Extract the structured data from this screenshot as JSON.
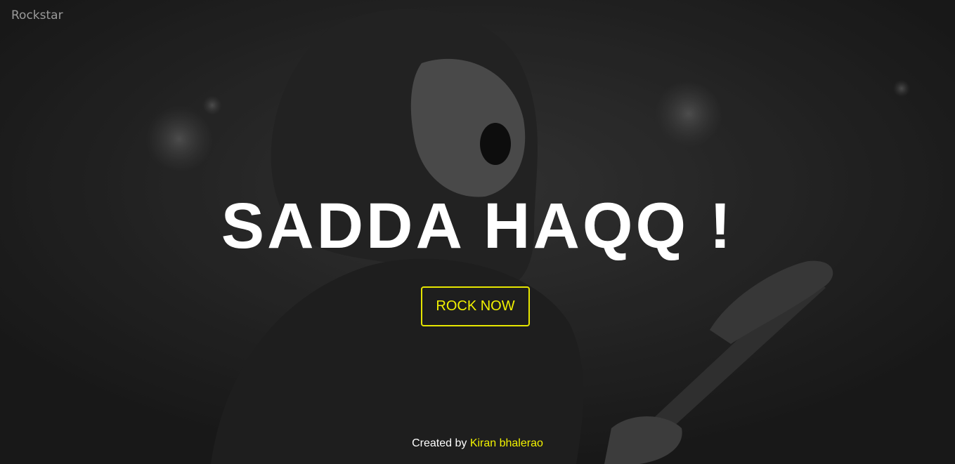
{
  "nav": {
    "brand": "Rockstar"
  },
  "hero": {
    "title": "SADDA HAQQ !",
    "cta_label": "ROCK NOW"
  },
  "footer": {
    "prefix": "Created by",
    "author": "Kiran bhalerao"
  },
  "colors": {
    "accent": "#f2f200",
    "text": "#ffffff",
    "brand_text": "#9a9a9a",
    "background": "#1c1c1c"
  },
  "background_image": {
    "subject": "black-and-white concert photo of a long-haired singer shouting while playing guitar"
  }
}
